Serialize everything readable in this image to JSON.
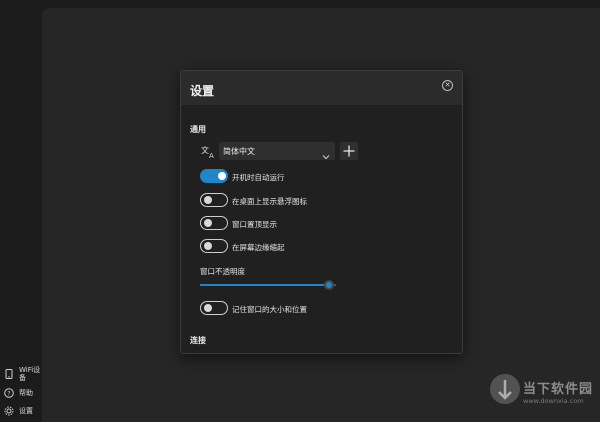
{
  "sidebar": {
    "items": [
      {
        "label": "WiFi设备",
        "icon": "phone-icon"
      },
      {
        "label": "帮助",
        "icon": "help-icon"
      },
      {
        "label": "设置",
        "icon": "gear-icon"
      }
    ]
  },
  "dialog": {
    "title": "设置",
    "close_icon": "close-icon",
    "sections": {
      "general": "通用",
      "connect": "连接"
    },
    "language": {
      "icon": "translate-icon",
      "value": "简体中文",
      "add_icon": "plus-icon"
    },
    "toggles": [
      {
        "label": "开机时自动运行",
        "on": true
      },
      {
        "label": "在桌面上显示悬浮图标",
        "on": false
      },
      {
        "label": "窗口置顶显示",
        "on": false
      },
      {
        "label": "在屏幕边缘缩起",
        "on": false
      }
    ],
    "opacity": {
      "label": "窗口不透明度",
      "value_fraction": 0.95
    },
    "remember": {
      "label": "记住窗口的大小和位置",
      "on": false
    }
  },
  "watermark": {
    "text": "当下软件园",
    "url": "www.downxia.com"
  },
  "colors": {
    "accent": "#1f86c8",
    "dialog_bg": "#202020",
    "header_bg": "#2b2b2b"
  }
}
